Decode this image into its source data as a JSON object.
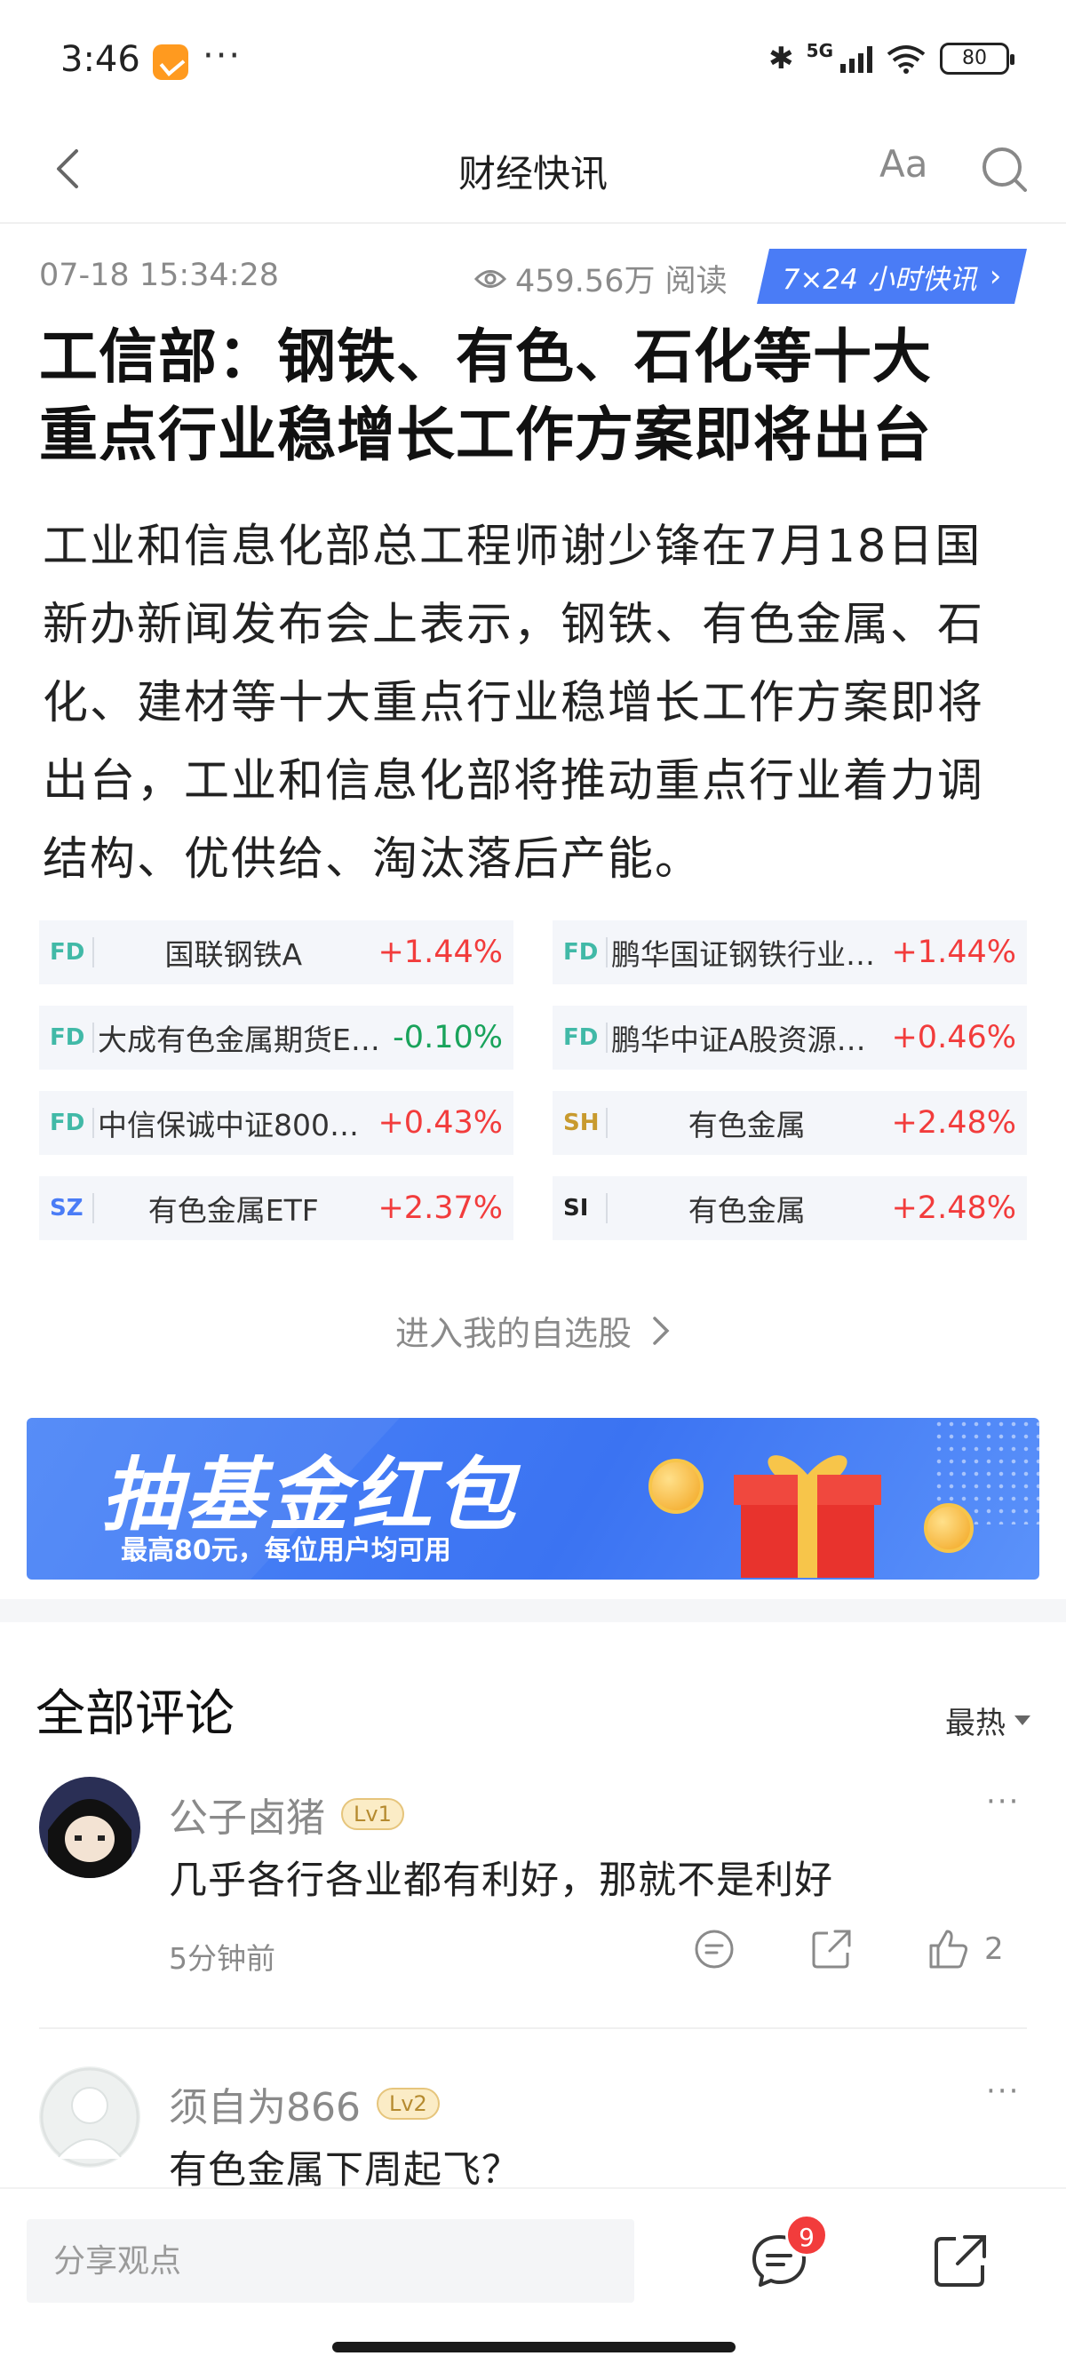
{
  "status_bar": {
    "time": "3:46",
    "dots": "···",
    "network": "5G",
    "battery": "80"
  },
  "nav": {
    "title": "财经快讯",
    "font_size_label": "Aa"
  },
  "article": {
    "datetime": "07-18 15:34:28",
    "views": "459.56万 阅读",
    "badge": "7×24 小时快讯",
    "headline_lines": [
      "工信部：钢铁、有色、石化等十大",
      "重点行业稳增长工作方案即将出台"
    ],
    "body_lines": [
      "工业和信息化部总工程师谢少锋在7月18日国",
      "新办新闻发布会上表示，钢铁、有色金属、石",
      "化、建材等十大重点行业稳增长工作方案即将",
      "出台，工业和信息化部将推动重点行业着力调",
      "结构、优供给、淘汰落后产能。"
    ]
  },
  "funds": [
    {
      "tag": "FD",
      "name": "国联钢铁A",
      "change": "+1.44%",
      "dir": "up"
    },
    {
      "tag": "FD",
      "name": "鹏华国证钢铁行业…",
      "change": "+1.44%",
      "dir": "up"
    },
    {
      "tag": "FD",
      "name": "大成有色金属期货E…",
      "change": "-0.10%",
      "dir": "down"
    },
    {
      "tag": "FD",
      "name": "鹏华中证A股资源…",
      "change": "+0.46%",
      "dir": "up"
    },
    {
      "tag": "FD",
      "name": "中信保诚中证800…",
      "change": "+0.43%",
      "dir": "up"
    },
    {
      "tag": "SH",
      "name": "有色金属",
      "change": "+2.48%",
      "dir": "up"
    },
    {
      "tag": "SZ",
      "name": "有色金属ETF",
      "change": "+2.37%",
      "dir": "up"
    },
    {
      "tag": "SI",
      "name": "有色金属",
      "change": "+2.48%",
      "dir": "up"
    }
  ],
  "watchlist_link": "进入我的自选股",
  "banner": {
    "title": "抽基金红包",
    "subtitle": "最高80元，每位用户均可用"
  },
  "comments_section": {
    "title": "全部评论",
    "sort_label": "最热"
  },
  "comments": [
    {
      "user": "公子卤猪",
      "level": "Lv1",
      "text": "几乎各行各业都有利好，那就不是利好",
      "time": "5分钟前",
      "likes": "2"
    },
    {
      "user": "须自为866",
      "level": "Lv2",
      "text": "有色金属下周起飞？"
    }
  ],
  "bottom_bar": {
    "input_placeholder": "分享观点",
    "comment_badge": "9"
  },
  "colors": {
    "up": "#f23c3c",
    "down": "#19a35b",
    "accent": "#4a7cf6"
  }
}
